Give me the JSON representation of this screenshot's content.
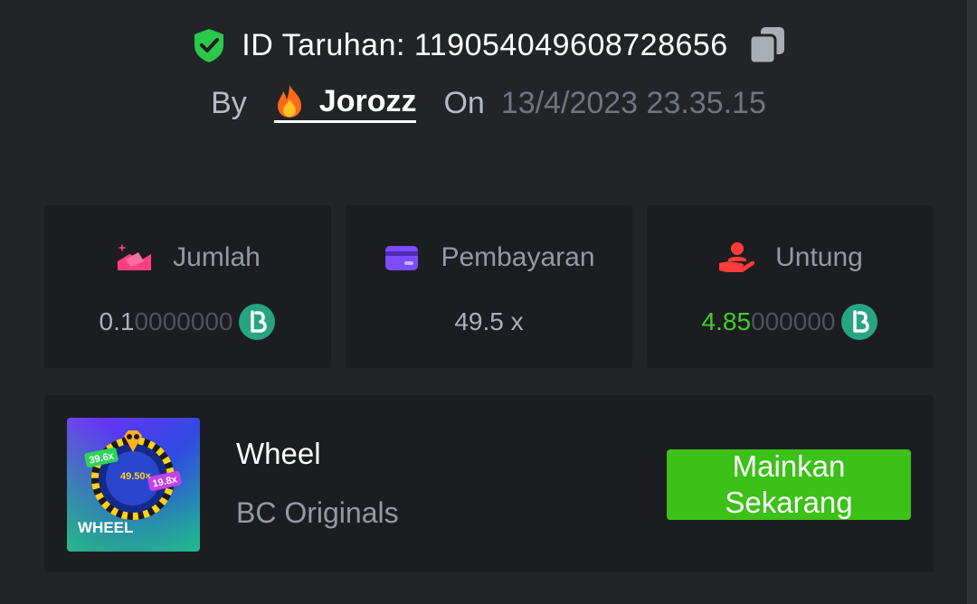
{
  "header": {
    "bet_id_text": "ID Taruhan: 119054049608728656",
    "icons": [
      "verified-shield-icon",
      "copy-icon"
    ]
  },
  "meta": {
    "by_label": "By",
    "username": "Jorozz",
    "on_label": "On",
    "datetime": "13/4/2023 23.35.15"
  },
  "stats": {
    "amount": {
      "label": "Jumlah",
      "value_main": "0.1",
      "value_dim": "0000000",
      "icon": "bet-amount-icon"
    },
    "payout": {
      "label": "Pembayaran",
      "value": "49.5 x",
      "icon": "card-icon"
    },
    "profit": {
      "label": "Untung",
      "value_main": "4.85",
      "value_dim": "000000",
      "icon": "profit-hand-icon"
    }
  },
  "game": {
    "name": "Wheel",
    "provider": "BC Originals",
    "play_label": "Mainkan Sekarang",
    "thumb": {
      "title": "WHEEL",
      "center": "49.50×",
      "left_tag": "39.6x",
      "right_tag": "19.8x"
    }
  },
  "colors": {
    "background": "#232427",
    "card": "#1c1d20",
    "accent_green": "#3bc117",
    "profit_green": "#3fcf2a",
    "coin_teal": "#27a583"
  }
}
